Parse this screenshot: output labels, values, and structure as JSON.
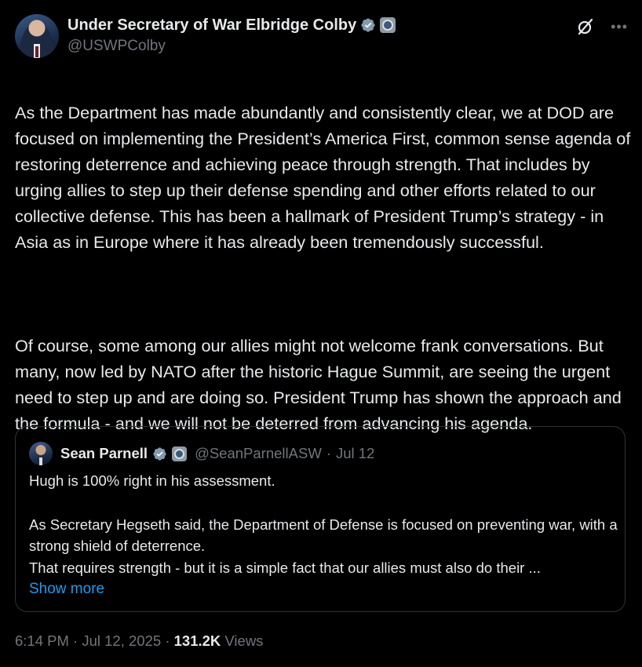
{
  "author": {
    "display_name": "Under Secretary of War Elbridge Colby",
    "handle": "@USWPColby"
  },
  "post": {
    "paragraphs": [
      "As the Department has made abundantly and consistently clear, we at DOD are focused on implementing the President’s America First, common sense agenda of restoring deterrence and achieving peace through strength. That includes by urging allies to step up their defense spending and other efforts related to our collective defense. This has been a hallmark of President Trump’s strategy - in Asia as in Europe where it has already been tremendously successful.",
      "Of course, some among our allies might not welcome frank conversations. But many, now led by NATO after the historic Hague Summit, are seeing the urgent need to step up and are doing so. President Trump has shown the approach and the formula - and we will not be deterred from advancing his agenda."
    ]
  },
  "quote": {
    "display_name": "Sean Parnell",
    "handle": "@SeanParnellASW",
    "separator": "·",
    "date": "Jul 12",
    "line1": "Hugh is 100% right in his assessment.",
    "line2": "As Secretary Hegseth said, the Department of Defense is focused on preventing war, with a strong shield of deterrence.",
    "line3": "That requires strength - but it is a simple fact that our allies must also do their ...",
    "show_more": "Show more"
  },
  "footer": {
    "time": "6:14 PM",
    "date": "Jul 12, 2025",
    "separator": "·",
    "views_count": "131.2K",
    "views_label": "Views"
  },
  "icons": {
    "verified": "verified-badge-icon",
    "government": "government-badge-icon",
    "grok": "grok-icon",
    "more": "more-icon"
  },
  "colors": {
    "background": "#000000",
    "text": "#e7e9ea",
    "muted": "#71767b",
    "link": "#1d9bf0",
    "verified": "#1d9bf0",
    "border": "#2f3336"
  }
}
